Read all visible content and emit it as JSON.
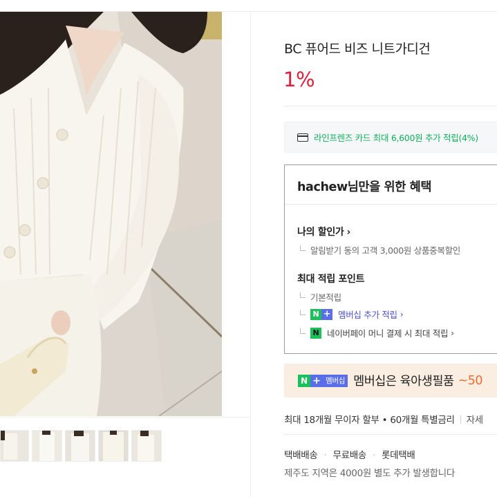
{
  "product": {
    "title": "BC 퓨어드 비즈 니트가디건",
    "discount": "1%"
  },
  "card_promo": {
    "icon": "credit-card-icon",
    "text": "라인프렌즈 카드 최대 6,600원 추가 적립(4%)"
  },
  "benefits": {
    "heading": "hachew님만을 위한 혜택",
    "my_price": {
      "label": "나의 할인가",
      "chevron": "›",
      "detail": "알림받기 동의 고객 3,000원 상품중복할인"
    },
    "max_points": {
      "label": "최대 적립 포인트",
      "basic": "기본적립",
      "membership": "멤버십 추가 적립",
      "membership_chevron": "›",
      "naverpay": "네이버페이 머니 결제 시 최대 적립",
      "naverpay_chevron": "›"
    }
  },
  "promo_banner": {
    "badge_n": "N",
    "badge_plus": "+",
    "badge_text": "멤버십",
    "text": "멤버십은 육아생필품",
    "accent": "~50"
  },
  "installment": {
    "text1": "최대 18개월 무이자 할부",
    "bullet": "•",
    "text2": "60개월 특별금리",
    "more": "자세"
  },
  "shipping": {
    "type": "택배배송",
    "fee": "무료배송",
    "courier": "롯데택배",
    "separator": "·",
    "note": "제주도 지역은 4000원 별도 추가 발생합니다"
  },
  "gallery": {
    "thumbnail_count": 5
  },
  "colors": {
    "discount": "#e01f3a",
    "card_text": "#0bb35a",
    "naver_green": "#19c15a",
    "membership_blue": "#5b6ee9",
    "promo_bg": "#faeee3",
    "promo_accent": "#f16b2d"
  }
}
